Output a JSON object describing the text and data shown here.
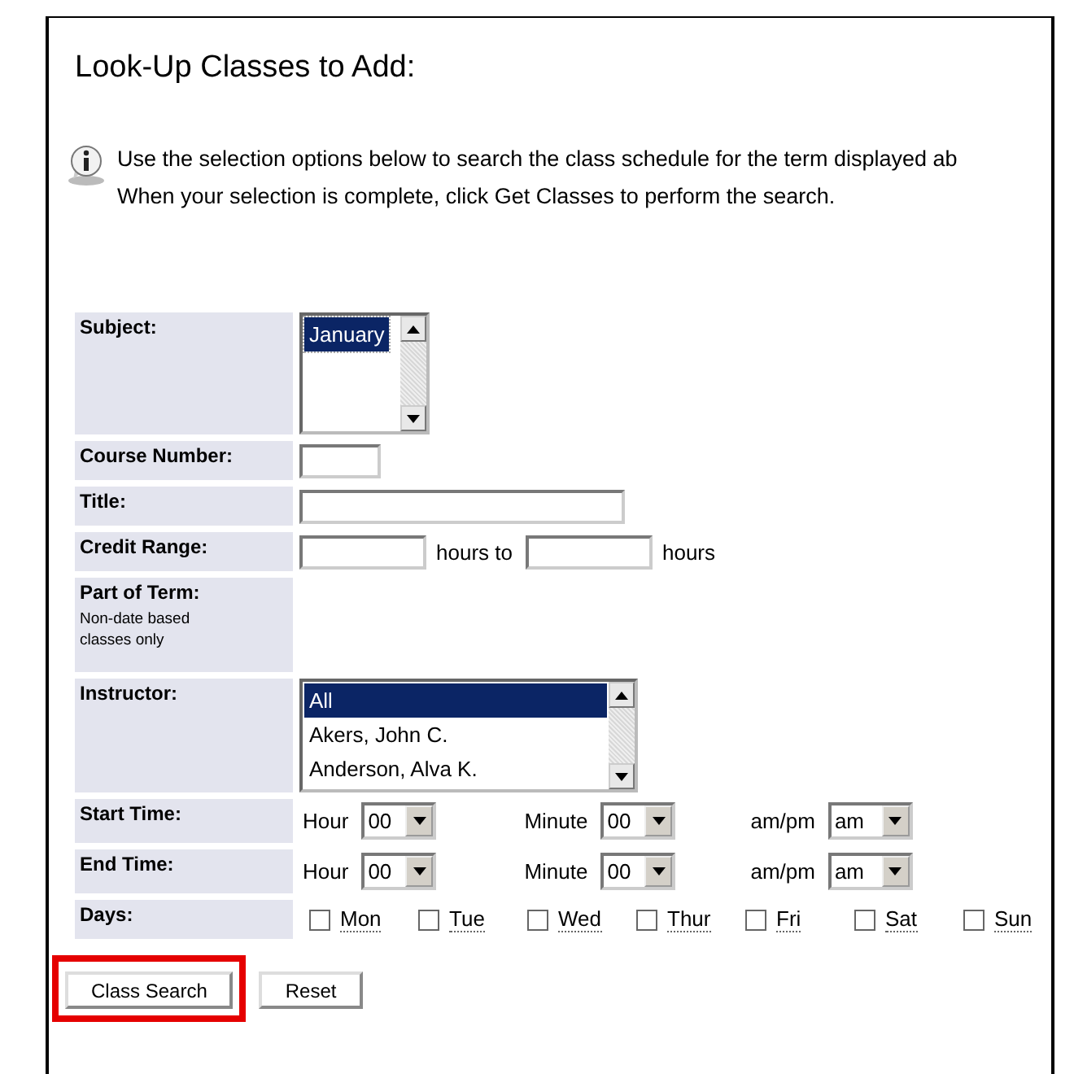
{
  "page": {
    "title": "Look-Up Classes to Add:"
  },
  "info": {
    "lines": [
      "Use the selection options below to search the class schedule for the term displayed ab",
      "When your selection is complete, click Get Classes to perform the search."
    ]
  },
  "form": {
    "subject": {
      "label": "Subject:",
      "options": [
        {
          "label": "January",
          "selected": true
        }
      ]
    },
    "course_number": {
      "label": "Course Number:"
    },
    "title": {
      "label": "Title:"
    },
    "credit_range": {
      "label": "Credit Range:",
      "middle": "hours to",
      "end": "hours"
    },
    "part_of_term": {
      "label": "Part of Term:",
      "note": "Non-date based classes only"
    },
    "instructor": {
      "label": "Instructor:",
      "options": [
        {
          "label": "All",
          "selected": true
        },
        {
          "label": "Akers, John C.",
          "selected": false
        },
        {
          "label": "Anderson, Alva K.",
          "selected": false
        }
      ]
    },
    "times": [
      {
        "label": "Start Time:",
        "hour_label": "Hour",
        "hour": "00",
        "minute_label": "Minute",
        "minute": "00",
        "ampm_label": "am/pm",
        "ampm": "am"
      },
      {
        "label": "End Time:",
        "hour_label": "Hour",
        "hour": "00",
        "minute_label": "Minute",
        "minute": "00",
        "ampm_label": "am/pm",
        "ampm": "am"
      }
    ],
    "days": {
      "label": "Days:",
      "items": [
        {
          "label": "Mon",
          "checked": false
        },
        {
          "label": "Tue",
          "checked": false
        },
        {
          "label": "Wed",
          "checked": false
        },
        {
          "label": "Thur",
          "checked": false
        },
        {
          "label": "Fri",
          "checked": false
        },
        {
          "label": "Sat",
          "checked": false
        },
        {
          "label": "Sun",
          "checked": false
        }
      ]
    }
  },
  "buttons": [
    {
      "label": "Class Search",
      "highlighted": true
    },
    {
      "label": "Reset",
      "highlighted": false
    }
  ]
}
